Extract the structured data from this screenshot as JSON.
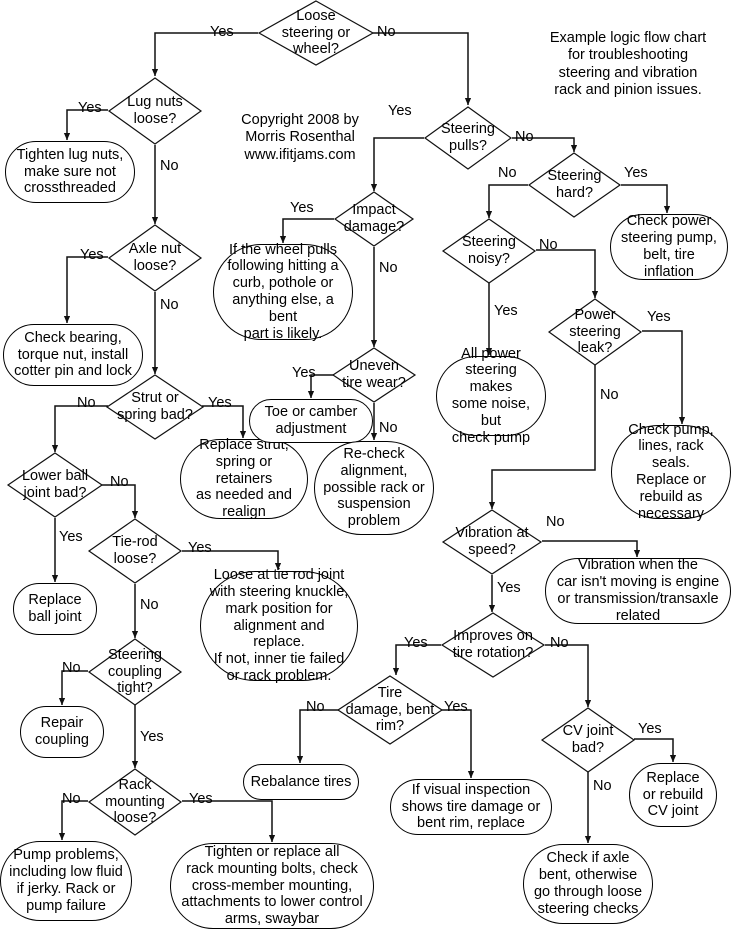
{
  "chart_data": {
    "type": "diagram",
    "title": "Example logic flow chart for troubleshooting steering and vibration rack and pinion issues.",
    "diagram_kind": "flowchart",
    "colors": {
      "line": "#000000",
      "background": "#ffffff",
      "text": "#000000"
    }
  },
  "annotations": {
    "title_block": "Example logic flow chart\nfor troubleshooting\nsteering and vibration\nrack and pinion issues.",
    "copyright_block": "Copyright 2008 by\nMorris Rosenthal\nwww.ifitjams.com"
  },
  "nodes": {
    "loose_steering": "Loose\nsteering or\nwheel?",
    "lug_nuts": "Lug nuts\nloose?",
    "tighten_lug": "Tighten lug nuts,\nmake sure not\ncrossthreaded",
    "axle_nut": "Axle nut\nloose?",
    "check_bearing": "Check bearing,\ntorque nut, install\ncotter pin and lock",
    "strut_spring": "Strut or\nspring bad?",
    "replace_strut": "Replace strut,\nspring or retainers\nas needed and\nrealign",
    "lower_ball": "Lower ball\njoint bad?",
    "replace_ball": "Replace\nball joint",
    "tie_rod": "Tie-rod\nloose?",
    "loose_tie_rod": "Loose at tie rod joint\nwith steering knuckle,\nmark position for\nalignment and replace.\nIf not, inner tie failed\nor rack problem.",
    "steering_coupling": "Steering\ncoupling\ntight?",
    "repair_coupling": "Repair\ncoupling",
    "rack_mounting": "Rack\nmounting\nloose?",
    "pump_problems": "Pump problems,\nincluding low fluid\nif jerky. Rack or\npump failure",
    "tighten_rack": "Tighten or replace all\nrack mounting bolts, check\ncross-member mounting,\nattachments to lower control\narms, swaybar",
    "steering_pulls": "Steering\npulls?",
    "impact_damage": "Impact\ndamage?",
    "wheel_pulls": "If the wheel pulls\nfollowing hitting a\ncurb, pothole or\nanything else, a bent\npart is likely.",
    "uneven_tire": "Uneven\ntire wear?",
    "toe_camber": "Toe or camber\nadjustment",
    "recheck_align": "Re-check\nalignment,\npossible rack or\nsuspension\nproblem",
    "steering_hard": "Steering\nhard?",
    "check_power": "Check power\nsteering pump,\nbelt, tire inflation",
    "steering_noisy": "Steering\nnoisy?",
    "all_power": "All power\nsteering makes\nsome noise, but\ncheck pump",
    "power_leak": "Power\nsteering\nleak?",
    "check_pump_lines": "Check pump,\nlines, rack seals.\nReplace or\nrebuild as\nnecessary",
    "vibration_speed": "Vibration at\nspeed?",
    "vibration_when": "Vibration when the\ncar isn't moving is engine\nor transmission/transaxle\nrelated",
    "improves_rotation": "Improves on\ntire rotation?",
    "tire_damage": "Tire\ndamage, bent\nrim?",
    "rebalance": "Rebalance tires",
    "visual_inspection": "If visual inspection\nshows tire damage or\nbent rim, replace",
    "cv_joint": "CV joint\nbad?",
    "replace_cv": "Replace\nor rebuild\nCV joint",
    "check_axle": "Check if axle\nbent, otherwise\ngo through loose\nsteering checks"
  },
  "edge_labels": {
    "l1": "Yes",
    "l2": "No",
    "l3": "Yes",
    "l4": "No",
    "l5": "Yes",
    "l6": "No",
    "l7": "No",
    "l8": "Yes",
    "l9": "Yes",
    "l10": "No",
    "l11": "Yes",
    "l12": "No",
    "l13": "No",
    "l14": "Yes",
    "l15": "No",
    "l16": "Yes",
    "l17": "Yes",
    "l18": "No",
    "l19": "Yes",
    "l20": "No",
    "l21": "Yes",
    "l22": "No",
    "l23": "No",
    "l24": "Yes",
    "l25": "No",
    "l26": "Yes",
    "l27": "Yes",
    "l28": "No",
    "l29": "Yes",
    "l30": "No",
    "l31": "Yes",
    "l32": "No",
    "l33": "No",
    "l34": "Yes",
    "l35": "Yes",
    "l36": "No"
  }
}
